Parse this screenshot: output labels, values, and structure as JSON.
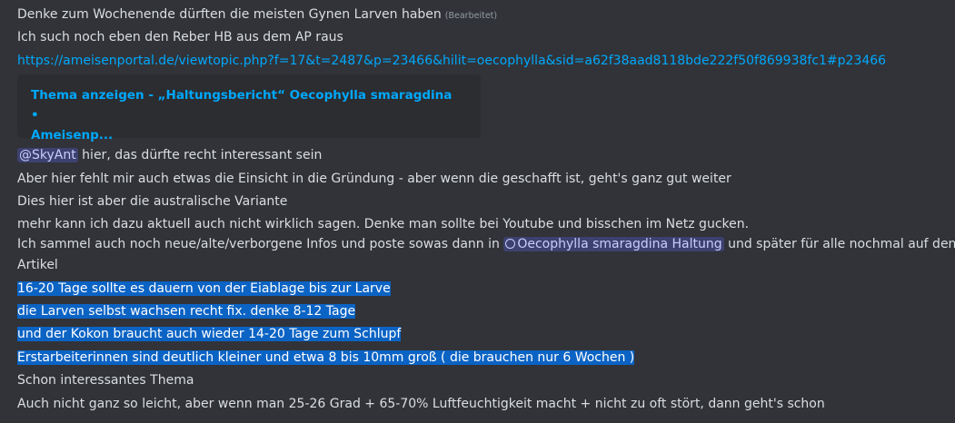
{
  "messages": {
    "line1_text": "Denke zum Wochenende dürften die meisten Gynen Larven haben",
    "line1_edited": "(Bearbeitet)",
    "line2_text": "Ich such noch eben den Reber HB aus dem AP raus",
    "link_url": "https://ameisenportal.de/viewtopic.php?f=17&t=2487&p=23466&hilit=oecophylla&sid=a62f38aad8118bde222f50f869938fc1#p23466",
    "embed_title_line1": "Thema anzeigen - „Haltungsbericht“ Oecophylla smaragdina •",
    "embed_title_line2": "Ameisenp...",
    "mention_user": "@SkyAnt",
    "mention_text": " hier, das dürfte recht interessant sein",
    "line_einsicht": "Aber hier fehlt mir auch etwas die Einsicht in die Gründung - aber wenn die geschafft ist, geht's ganz gut weiter",
    "line_variante": "Dies hier ist aber die australische Variante",
    "line_youtube": "mehr kann ich dazu aktuell auch nicht wirklich sagen. Denke man sollte bei Youtube und bisschen im Netz gucken.",
    "line_sammel_before": "Ich sammel auch noch neue/alte/verborgene Infos und poste sowas dann in ",
    "channel_name": "Oecophylla smaragdina Haltung",
    "line_sammel_after": " und später für alle nochmal auf den Blog",
    "line_artikel": "Artikel",
    "selected_line1": "16-20 Tage sollte es dauern von der Eiablage bis zur Larve",
    "selected_line2": "die Larven selbst wachsen recht fix. denke 8-12 Tage",
    "selected_line3": "und der Kokon braucht auch wieder 14-20 Tage zum Schlupf",
    "selected_line4": "Erstarbeiterinnen sind deutlich kleiner und etwa 8 bis 10mm groß ( die brauchen nur 6 Wochen )",
    "line_thema": "Schon interessantes Thema",
    "line_last": "Auch nicht ganz so leicht, aber wenn man 25-26 Grad + 65-70% Luftfeuchtigkeit macht + nicht zu oft stört, dann geht's schon"
  },
  "colors": {
    "background": "#313338",
    "text": "#dbdee1",
    "link": "#00a8fc",
    "embed_background": "#2b2d31",
    "mention_background": "#3c4270",
    "selection": "#0b63c4"
  },
  "icons": {
    "channel": "thread-icon"
  }
}
